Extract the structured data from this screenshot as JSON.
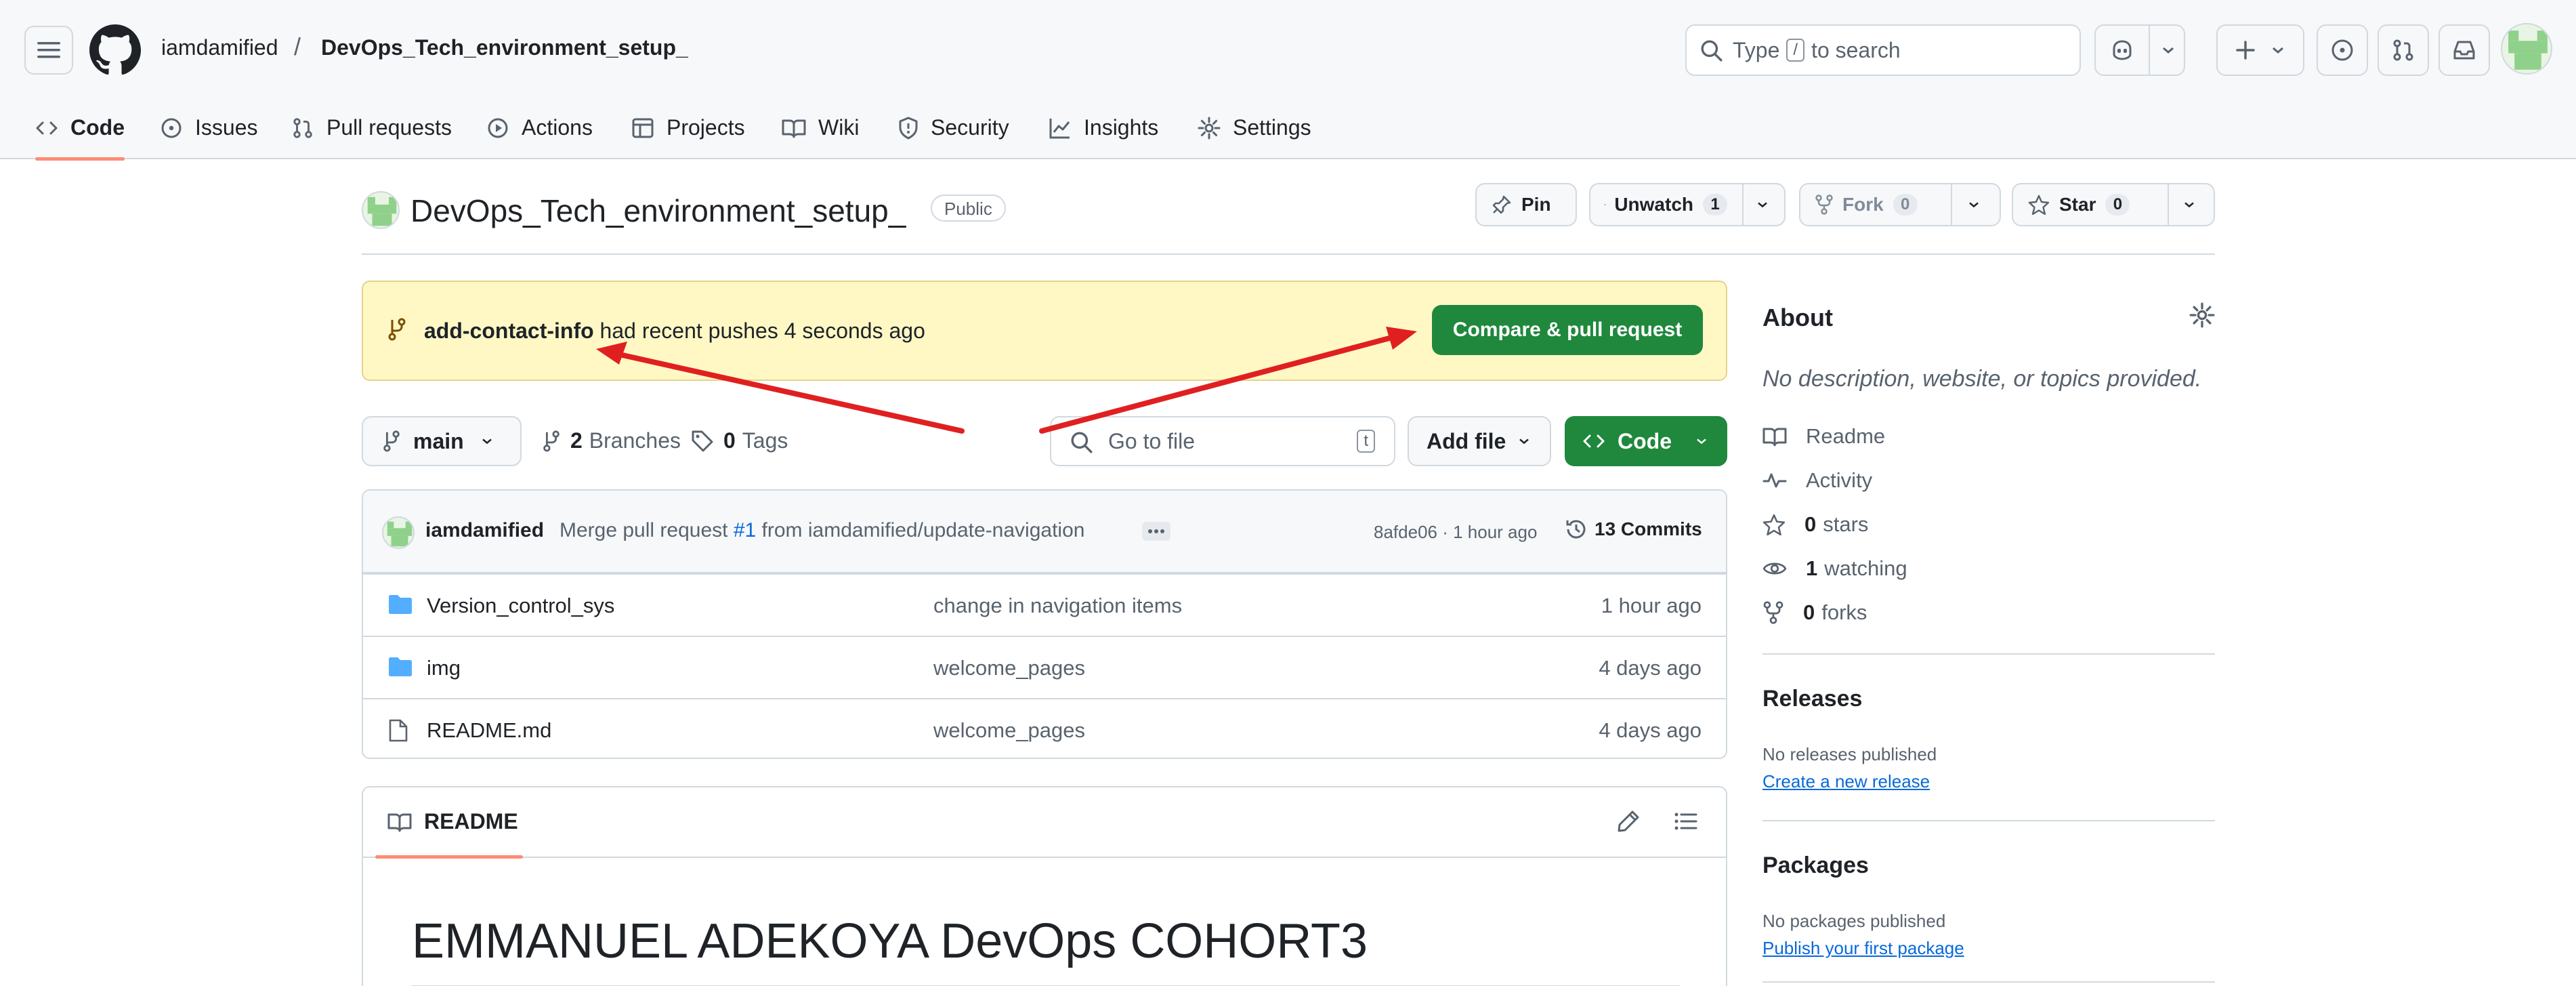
{
  "header": {
    "owner": "iamdamified",
    "separator": "/",
    "repo": "DevOps_Tech_environment_setup_",
    "search_prefix": "Type",
    "search_key": "/",
    "search_suffix": "to search"
  },
  "tabs": [
    {
      "label": "Code",
      "icon": "code-icon"
    },
    {
      "label": "Issues",
      "icon": "issue-icon"
    },
    {
      "label": "Pull requests",
      "icon": "pull-request-icon"
    },
    {
      "label": "Actions",
      "icon": "play-icon"
    },
    {
      "label": "Projects",
      "icon": "table-icon"
    },
    {
      "label": "Wiki",
      "icon": "book-icon"
    },
    {
      "label": "Security",
      "icon": "shield-icon"
    },
    {
      "label": "Insights",
      "icon": "graph-icon"
    },
    {
      "label": "Settings",
      "icon": "gear-icon"
    }
  ],
  "repo": {
    "name": "DevOps_Tech_environment_setup_",
    "visibility": "Public",
    "pin_label": "Pin",
    "watch_label": "Unwatch",
    "watch_count": "1",
    "fork_label": "Fork",
    "fork_count": "0",
    "star_label": "Star",
    "star_count": "0"
  },
  "banner": {
    "branch": "add-contact-info",
    "text": "had recent pushes 4 seconds ago",
    "button": "Compare & pull request"
  },
  "toolbar": {
    "branch": "main",
    "branches_count": "2",
    "branches_label": "Branches",
    "tags_count": "0",
    "tags_label": "Tags",
    "goto_placeholder": "Go to file",
    "goto_key": "t",
    "addfile_label": "Add file",
    "code_label": "Code"
  },
  "commit": {
    "author": "iamdamified",
    "msg_prefix": "Merge pull request",
    "pr": "#1",
    "msg_suffix": "from iamdamified/update-navigation",
    "sha_time": "8afde06 · 1 hour ago",
    "count_label": "13 Commits"
  },
  "files": [
    {
      "name": "Version_control_sys",
      "type": "folder",
      "commit": "change in navigation items",
      "time": "1 hour ago"
    },
    {
      "name": "img",
      "type": "folder",
      "commit": "welcome_pages",
      "time": "4 days ago"
    },
    {
      "name": "README.md",
      "type": "file",
      "commit": "welcome_pages",
      "time": "4 days ago"
    }
  ],
  "readme": {
    "tab_label": "README",
    "heading": "EMMANUEL ADEKOYA DevOps COHORT3"
  },
  "about": {
    "title": "About",
    "description": "No description, website, or topics provided.",
    "readme": "Readme",
    "activity": "Activity",
    "stars_count": "0",
    "stars_label": "stars",
    "watching_count": "1",
    "watching_label": "watching",
    "forks_count": "0",
    "forks_label": "forks"
  },
  "releases": {
    "title": "Releases",
    "none": "No releases published",
    "link": "Create a new release"
  },
  "packages": {
    "title": "Packages",
    "none": "No packages published",
    "link": "Publish your first package"
  },
  "colors": {
    "accent_green": "#1f883d",
    "banner_yellow": "#fff8c5",
    "tab_underline": "#fd8c73",
    "link_blue": "#0969da",
    "arrow_red": "#e02020"
  }
}
